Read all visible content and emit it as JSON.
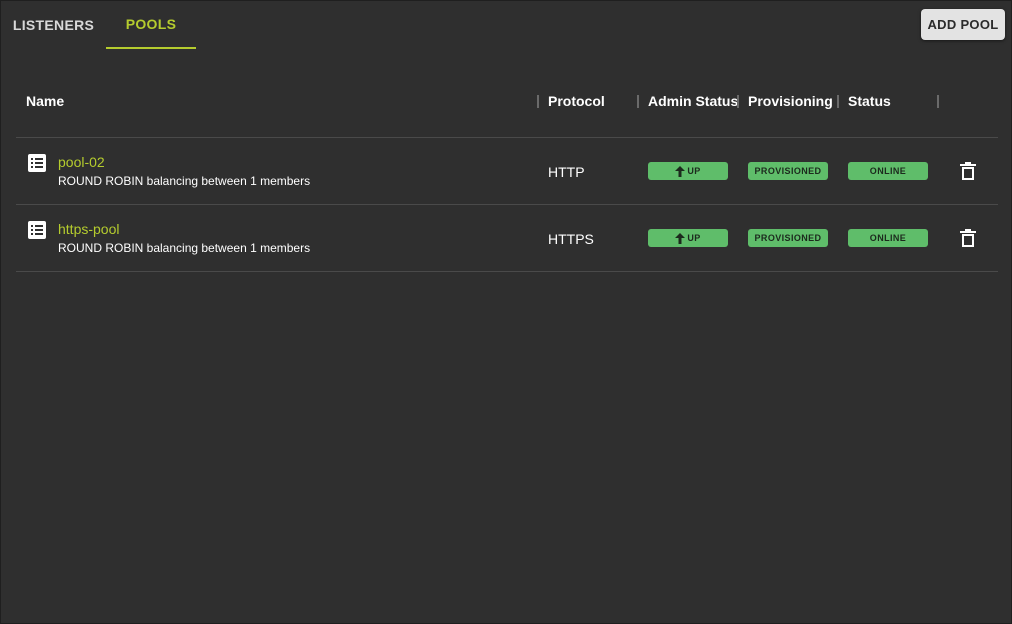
{
  "tabs": [
    {
      "label": "LISTENERS",
      "active": false
    },
    {
      "label": "POOLS",
      "active": true
    }
  ],
  "add_button": {
    "label": "ADD POOL"
  },
  "table": {
    "columns": [
      "Name",
      "Protocol",
      "Admin Status",
      "Provisioning",
      "Status"
    ],
    "rows": [
      {
        "name": "pool-02",
        "description": "ROUND ROBIN balancing between 1 members",
        "protocol": "HTTP",
        "admin_status": "UP",
        "provisioning": "PROVISIONED",
        "status": "ONLINE"
      },
      {
        "name": "https-pool",
        "description": "ROUND ROBIN balancing between 1 members",
        "protocol": "HTTPS",
        "admin_status": "UP",
        "provisioning": "PROVISIONED",
        "status": "ONLINE"
      }
    ]
  },
  "icons": {
    "row_icon": "list-icon",
    "admin_icon": "arrow-up-icon",
    "delete_icon": "trash-icon"
  },
  "colors": {
    "background": "#2f2f2f",
    "accent": "#b5cc2e",
    "badge_green": "#5fbd6a",
    "button_bg": "#e3e3e3"
  }
}
